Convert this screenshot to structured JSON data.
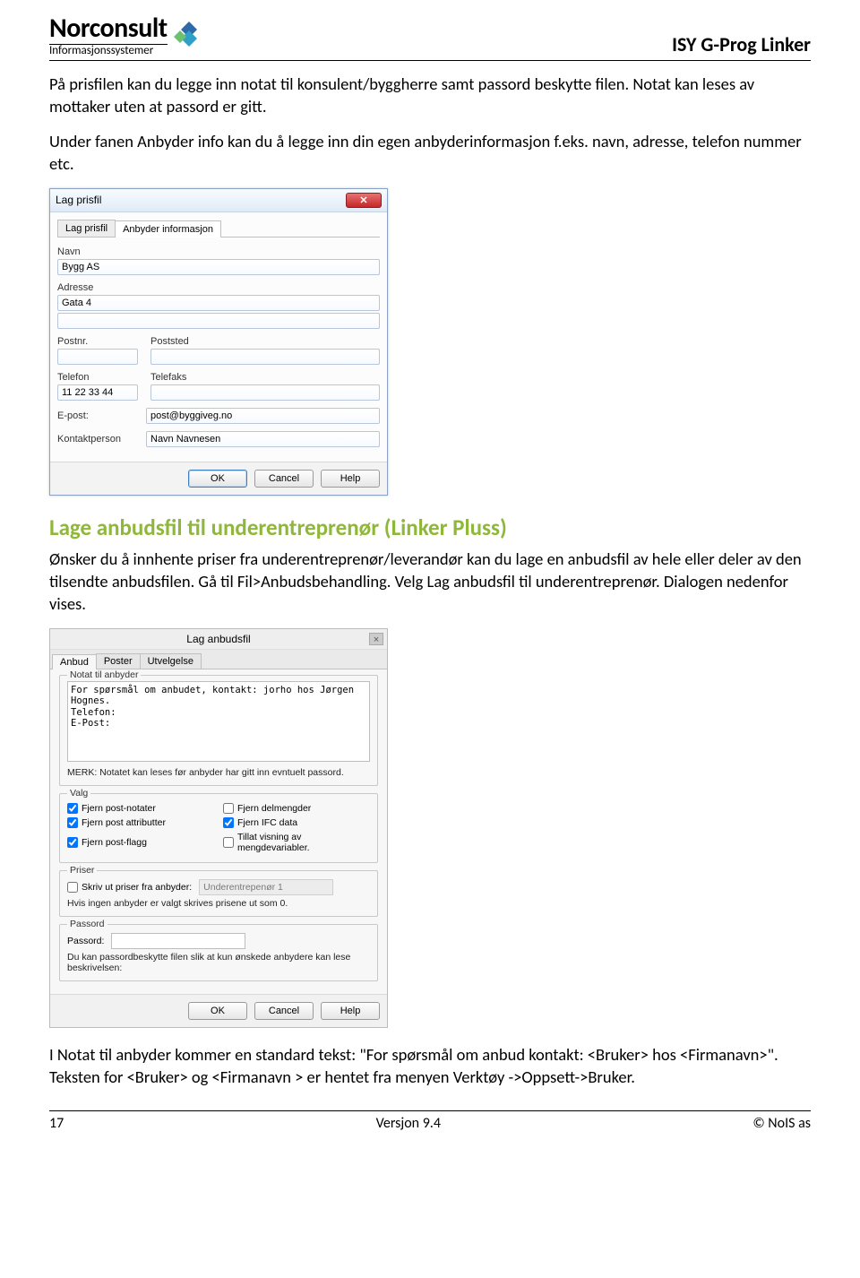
{
  "header": {
    "logo_name": "Norconsult",
    "logo_sub": "Informasjonssystemer",
    "doc_title": "ISY G-Prog Linker"
  },
  "para1": "På prisfilen kan du legge inn notat til konsulent/byggherre samt passord beskytte filen. Notat kan leses av mottaker uten at passord er gitt.",
  "para2": "Under fanen Anbyder info kan du å legge inn din egen anbyderinformasjon f.eks. navn, adresse, telefon nummer etc.",
  "dialog1": {
    "title": "Lag prisfil",
    "tabs": [
      "Lag prisfil",
      "Anbyder informasjon"
    ],
    "active_tab": 1,
    "fields": {
      "navn_label": "Navn",
      "navn_value": "Bygg AS",
      "adresse_label": "Adresse",
      "adresse_value": "Gata 4",
      "postnr_label": "Postnr.",
      "postnr_value": "",
      "poststed_label": "Poststed",
      "poststed_value": "",
      "telefon_label": "Telefon",
      "telefon_value": "11 22 33 44",
      "telefaks_label": "Telefaks",
      "telefaks_value": "",
      "epost_label": "E-post:",
      "epost_value": "post@byggiveg.no",
      "kontakt_label": "Kontaktperson",
      "kontakt_value": "Navn Navnesen"
    },
    "buttons": {
      "ok": "OK",
      "cancel": "Cancel",
      "help": "Help"
    }
  },
  "section_heading": "Lage anbudsfil til underentreprenør (Linker Pluss)",
  "para3": "Ønsker du å innhente priser fra underentreprenør/leverandør kan du lage en anbudsfil av hele eller deler av den tilsendte anbudsfilen. Gå til Fil>Anbudsbehandling. Velg Lag anbudsfil til underentreprenør. Dialogen nedenfor vises.",
  "dialog2": {
    "title": "Lag anbudsfil",
    "tabs": [
      "Anbud",
      "Poster",
      "Utvelgelse"
    ],
    "active_tab": 0,
    "notat_legend": "Notat til anbyder",
    "notat_text": "For spørsmål om anbudet, kontakt: jorho hos Jørgen Hognes.\nTelefon:\nE-Post:",
    "notat_note": "MERK: Notatet kan leses før anbyder har gitt inn evntuelt passord.",
    "valg_legend": "Valg",
    "checks": {
      "post_notater": "Fjern post-notater",
      "delmengder": "Fjern delmengder",
      "post_attributter": "Fjern post attributter",
      "ifc": "Fjern IFC data",
      "post_flagg": "Fjern post-flagg",
      "mengdevar": "Tillat visning av mengdevariabler."
    },
    "priser_legend": "Priser",
    "priser_check": "Skriv ut priser fra anbyder:",
    "priser_select": "Underentrepenør 1",
    "priser_note": "Hvis ingen anbyder er valgt skrives prisene ut som 0.",
    "passord_legend": "Passord",
    "passord_label": "Passord:",
    "passord_note": "Du kan passordbeskytte filen slik at kun ønskede anbydere kan lese beskrivelsen:",
    "buttons": {
      "ok": "OK",
      "cancel": "Cancel",
      "help": "Help"
    }
  },
  "para4": "I Notat til anbyder kommer en standard tekst: \"For spørsmål om anbud kontakt: <Bruker> hos <Firmanavn>\". Teksten for <Bruker> og <Firmanavn > er hentet fra menyen Verktøy ->Oppsett->Bruker.",
  "footer": {
    "page": "17",
    "version": "Versjon 9.4",
    "copyright": "© NoIS as"
  }
}
